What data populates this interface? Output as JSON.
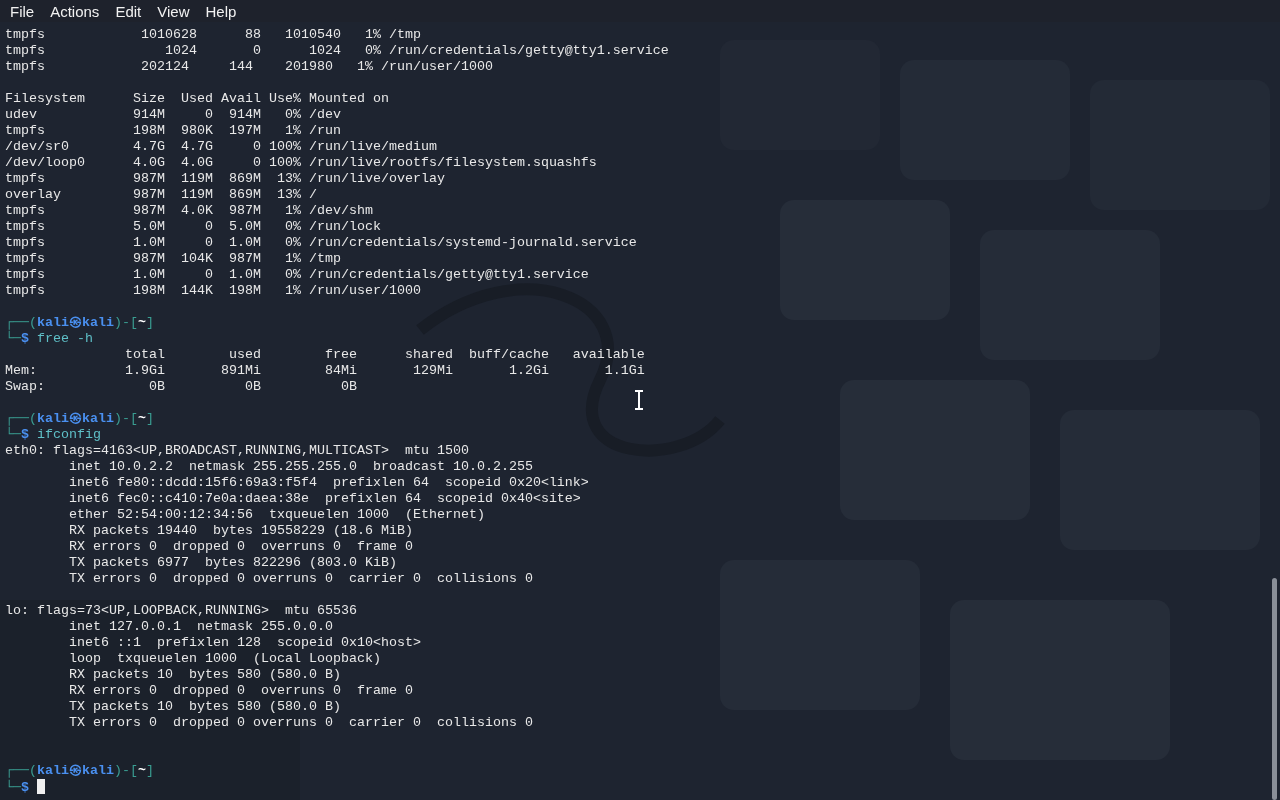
{
  "menu": [
    {
      "label": "File"
    },
    {
      "label": "Actions"
    },
    {
      "label": "Edit"
    },
    {
      "label": "View"
    },
    {
      "label": "Help"
    }
  ],
  "lines": [
    {
      "kind": "output",
      "text": "tmpfs            1010628      88   1010540   1% /tmp"
    },
    {
      "kind": "output",
      "text": "tmpfs               1024       0      1024   0% /run/credentials/getty@tty1.service"
    },
    {
      "kind": "output",
      "text": "tmpfs            202124     144    201980   1% /run/user/1000"
    },
    {
      "kind": "blank"
    },
    {
      "kind": "output",
      "text": "Filesystem      Size  Used Avail Use% Mounted on"
    },
    {
      "kind": "output",
      "text": "udev            914M     0  914M   0% /dev"
    },
    {
      "kind": "output",
      "text": "tmpfs           198M  980K  197M   1% /run"
    },
    {
      "kind": "output",
      "text": "/dev/sr0        4.7G  4.7G     0 100% /run/live/medium"
    },
    {
      "kind": "output",
      "text": "/dev/loop0      4.0G  4.0G     0 100% /run/live/rootfs/filesystem.squashfs"
    },
    {
      "kind": "output",
      "text": "tmpfs           987M  119M  869M  13% /run/live/overlay"
    },
    {
      "kind": "output",
      "text": "overlay         987M  119M  869M  13% /"
    },
    {
      "kind": "output",
      "text": "tmpfs           987M  4.0K  987M   1% /dev/shm"
    },
    {
      "kind": "output",
      "text": "tmpfs           5.0M     0  5.0M   0% /run/lock"
    },
    {
      "kind": "output",
      "text": "tmpfs           1.0M     0  1.0M   0% /run/credentials/systemd-journald.service"
    },
    {
      "kind": "output",
      "text": "tmpfs           987M  104K  987M   1% /tmp"
    },
    {
      "kind": "output",
      "text": "tmpfs           1.0M     0  1.0M   0% /run/credentials/getty@tty1.service"
    },
    {
      "kind": "output",
      "text": "tmpfs           198M  144K  198M   1% /run/user/1000"
    },
    {
      "kind": "blank"
    },
    {
      "kind": "prompt",
      "open": "┌──(",
      "user": "kali",
      "at": "㉿",
      "host": "kali",
      "mid": ")-[",
      "dir": "~",
      "close": "]"
    },
    {
      "kind": "command",
      "prefix": "└─",
      "sigil": "$",
      "text": "free -h",
      "cursor": false
    },
    {
      "kind": "output",
      "text": "               total        used        free      shared  buff/cache   available"
    },
    {
      "kind": "output",
      "text": "Mem:           1.9Gi       891Mi        84Mi       129Mi       1.2Gi       1.1Gi"
    },
    {
      "kind": "output",
      "text": "Swap:             0B          0B          0B"
    },
    {
      "kind": "blank"
    },
    {
      "kind": "prompt",
      "open": "┌──(",
      "user": "kali",
      "at": "㉿",
      "host": "kali",
      "mid": ")-[",
      "dir": "~",
      "close": "]"
    },
    {
      "kind": "command",
      "prefix": "└─",
      "sigil": "$",
      "text": "ifconfig",
      "cursor": false
    },
    {
      "kind": "output",
      "text": "eth0: flags=4163<UP,BROADCAST,RUNNING,MULTICAST>  mtu 1500"
    },
    {
      "kind": "output",
      "text": "        inet 10.0.2.2  netmask 255.255.255.0  broadcast 10.0.2.255"
    },
    {
      "kind": "output",
      "text": "        inet6 fe80::dcdd:15f6:69a3:f5f4  prefixlen 64  scopeid 0x20<link>"
    },
    {
      "kind": "output",
      "text": "        inet6 fec0::c410:7e0a:daea:38e  prefixlen 64  scopeid 0x40<site>"
    },
    {
      "kind": "output",
      "text": "        ether 52:54:00:12:34:56  txqueuelen 1000  (Ethernet)"
    },
    {
      "kind": "output",
      "text": "        RX packets 19440  bytes 19558229 (18.6 MiB)"
    },
    {
      "kind": "output",
      "text": "        RX errors 0  dropped 0  overruns 0  frame 0"
    },
    {
      "kind": "output",
      "text": "        TX packets 6977  bytes 822296 (803.0 KiB)"
    },
    {
      "kind": "output",
      "text": "        TX errors 0  dropped 0 overruns 0  carrier 0  collisions 0"
    },
    {
      "kind": "blank"
    },
    {
      "kind": "output",
      "text": "lo: flags=73<UP,LOOPBACK,RUNNING>  mtu 65536"
    },
    {
      "kind": "output",
      "text": "        inet 127.0.0.1  netmask 255.0.0.0"
    },
    {
      "kind": "output",
      "text": "        inet6 ::1  prefixlen 128  scopeid 0x10<host>"
    },
    {
      "kind": "output",
      "text": "        loop  txqueuelen 1000  (Local Loopback)"
    },
    {
      "kind": "output",
      "text": "        RX packets 10  bytes 580 (580.0 B)"
    },
    {
      "kind": "output",
      "text": "        RX errors 0  dropped 0  overruns 0  frame 0"
    },
    {
      "kind": "output",
      "text": "        TX packets 10  bytes 580 (580.0 B)"
    },
    {
      "kind": "output",
      "text": "        TX errors 0  dropped 0 overruns 0  carrier 0  collisions 0"
    },
    {
      "kind": "blank"
    },
    {
      "kind": "blank"
    },
    {
      "kind": "prompt",
      "open": "┌──(",
      "user": "kali",
      "at": "㉿",
      "host": "kali",
      "mid": ")-[",
      "dir": "~",
      "close": "]"
    },
    {
      "kind": "command",
      "prefix": "└─",
      "sigil": "$",
      "cursor": true
    }
  ]
}
